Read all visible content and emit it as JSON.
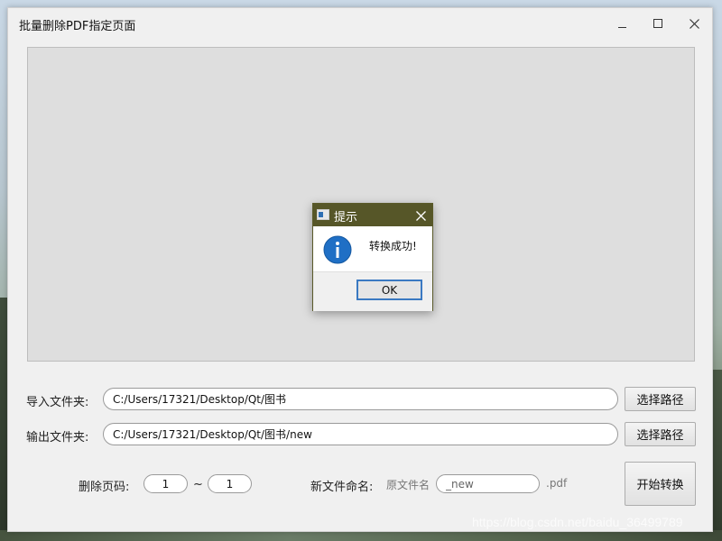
{
  "window": {
    "title": "批量删除PDF指定页面"
  },
  "import_row": {
    "label": "导入文件夹:",
    "value": "C:/Users/17321/Desktop/Qt/图书",
    "button": "选择路径"
  },
  "export_row": {
    "label": "输出文件夹:",
    "value": "C:/Users/17321/Desktop/Qt/图书/new",
    "button": "选择路径"
  },
  "pages": {
    "label": "删除页码:",
    "from": "1",
    "separator": "~",
    "to": "1"
  },
  "rename": {
    "label": "新文件命名:",
    "prefix": "原文件名",
    "suffix_value": "_new",
    "extension": ".pdf"
  },
  "start_button": "开始转换",
  "dialog": {
    "title": "提示",
    "message": "转换成功!",
    "ok": "OK",
    "icon": "info-icon"
  },
  "watermark": "https://blog.csdn.net/baidu_36499789"
}
